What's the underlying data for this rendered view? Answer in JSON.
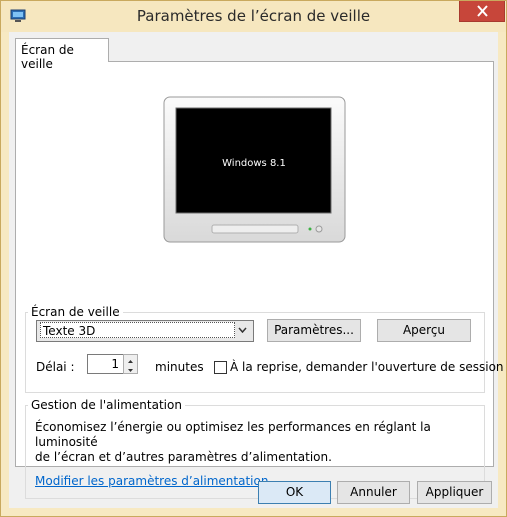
{
  "window": {
    "title": "Paramètres de l’écran de veille",
    "icon": "monitor-settings-icon",
    "close_icon": "close-icon"
  },
  "tabs": [
    {
      "label": "Écran de veille",
      "selected": true
    }
  ],
  "preview": {
    "screen_text": "Windows 8.1"
  },
  "screensaver_group": {
    "label": "Écran de veille",
    "selected_option": "Texte 3D",
    "settings_button": "Paramètres...",
    "preview_button": "Aperçu",
    "delay_label": "Délai :",
    "delay_value": "1",
    "delay_unit": "minutes",
    "resume_checkbox_label": "À la reprise, demander l'ouverture de session",
    "resume_checked": false
  },
  "power_group": {
    "label": "Gestion de l'alimentation",
    "description_line1": "Économisez l’énergie ou optimisez les performances en réglant la luminosité",
    "description_line2": "de l’écran et d’autres paramètres d’alimentation.",
    "link": "Modifier les paramètres d’alimentation"
  },
  "footer": {
    "ok": "OK",
    "cancel": "Annuler",
    "apply": "Appliquer"
  },
  "colors": {
    "frame": "#f7e9c2",
    "close": "#c7463a",
    "link": "#0066cc"
  }
}
